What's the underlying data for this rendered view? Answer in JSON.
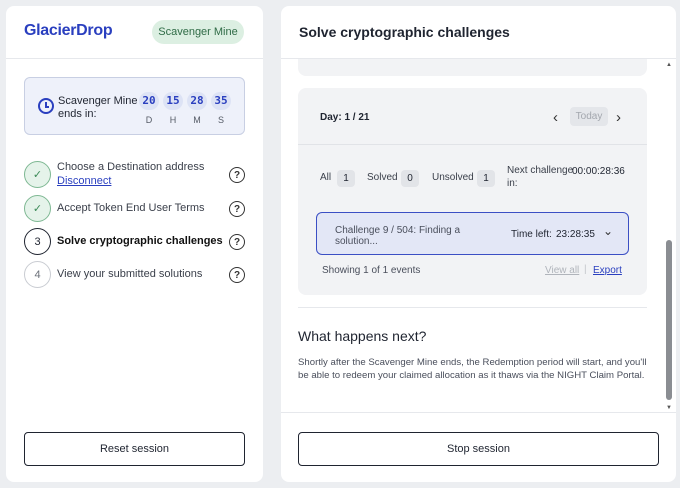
{
  "left": {
    "logo": "GlacierDrop",
    "badge": "Scavenger Mine",
    "countdown": {
      "label": "Scavenger Mine ends in:",
      "units": [
        {
          "value": "20",
          "letter": "D"
        },
        {
          "value": "15",
          "letter": "H"
        },
        {
          "value": "28",
          "letter": "M"
        },
        {
          "value": "35",
          "letter": "S"
        }
      ]
    },
    "steps": [
      {
        "marker": "✓",
        "label": "Choose a Destination address",
        "link": "Disconnect",
        "help": "?"
      },
      {
        "marker": "✓",
        "label": "Accept Token End User Terms",
        "help": "?"
      },
      {
        "marker": "3",
        "label": "Solve cryptographic challenges",
        "help": "?"
      },
      {
        "marker": "4",
        "label": "View your submitted solutions",
        "help": "?"
      }
    ],
    "reset_label": "Reset session"
  },
  "right": {
    "title": "Solve cryptographic challenges",
    "day": {
      "label": "Day: 1 / 21",
      "prev": "‹",
      "today": "Today",
      "next": "›"
    },
    "filters": {
      "all_label": "All",
      "all_count": "1",
      "solved_label": "Solved",
      "solved_count": "0",
      "unsolved_label": "Unsolved",
      "unsolved_count": "1",
      "next_label": "Next challenge in:",
      "next_time": "00:00:28:36"
    },
    "challenge": {
      "title": "Challenge 9 / 504: Finding a solution...",
      "time_left_label": "Time left:",
      "time_left": "23:28:35",
      "chevron": "⌄"
    },
    "showing": "Showing 1 of 1 events",
    "view_all": "View all",
    "separator": "|",
    "export": "Export",
    "what_next": {
      "title": "What happens next?",
      "text": "Shortly after the Scavenger Mine ends, the Redemption period will start, and you'll be able to redeem your claimed allocation as it thaws via the NIGHT Claim Portal."
    },
    "stop_label": "Stop session"
  },
  "colors": {
    "brand": "#2a3fbf",
    "badge_bg": "#dcefe2",
    "done_green": "#3b8a57",
    "challenge_bg": "#e3e7f6"
  }
}
